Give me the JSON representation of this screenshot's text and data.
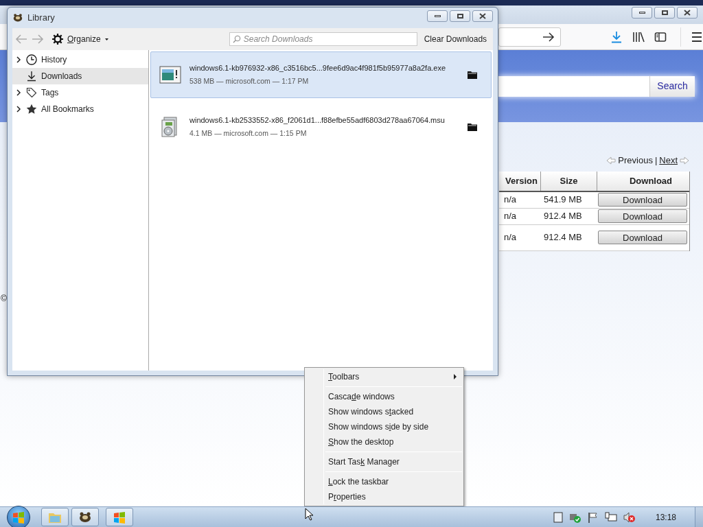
{
  "browser": {
    "search_button": "Search",
    "pager": {
      "previous": "Previous",
      "separator": "|",
      "next": "Next"
    },
    "table": {
      "columns": [
        "Version",
        "Size",
        "Download"
      ],
      "rows": [
        {
          "version": "n/a",
          "size": "541.9 MB",
          "button": "Download",
          "tall": false
        },
        {
          "version": "n/a",
          "size": "912.4 MB",
          "button": "Download",
          "tall": false
        },
        {
          "version": "n/a",
          "size": "912.4 MB",
          "button": "Download",
          "tall": true
        }
      ]
    },
    "edge_fragment": "©"
  },
  "library": {
    "title": "Library",
    "organize": {
      "key": "O",
      "post": "rganize"
    },
    "search": {
      "placeholder": "Search Downloads"
    },
    "clear_button": "Clear Downloads",
    "sidebar": [
      {
        "label": "History",
        "kind": "history",
        "collapsible": true,
        "selected": false
      },
      {
        "label": "Downloads",
        "kind": "downloads",
        "collapsible": false,
        "selected": true
      },
      {
        "label": "Tags",
        "kind": "tags",
        "collapsible": true,
        "selected": false
      },
      {
        "label": "All Bookmarks",
        "kind": "bookmarks",
        "collapsible": true,
        "selected": false
      }
    ],
    "downloads": [
      {
        "name": "windows6.1-kb976932-x86_c3516bc5...9fee6d9ac4f981f5b95977a8a2fa.exe",
        "details": "538 MB — microsoft.com — 1:17 PM",
        "kind": "exe",
        "selected": true
      },
      {
        "name": "windows6.1-kb2533552-x86_f2061d1...f88efbe55adf6803d278aa67064.msu",
        "details": "4.1 MB — microsoft.com — 1:15 PM",
        "kind": "msu",
        "selected": false
      }
    ]
  },
  "context_menu": [
    {
      "kind": "item",
      "key": "T",
      "post": "oolbars",
      "submenu": true
    },
    {
      "kind": "separator"
    },
    {
      "kind": "item",
      "pre": "Casca",
      "key": "d",
      "post": "e windows",
      "submenu": false
    },
    {
      "kind": "item",
      "pre": "Show windows s",
      "key": "t",
      "post": "acked",
      "submenu": false
    },
    {
      "kind": "item",
      "pre": "Show windows s",
      "key": "i",
      "post": "de by side",
      "submenu": false
    },
    {
      "kind": "item",
      "key": "S",
      "post": "how the desktop",
      "submenu": false
    },
    {
      "kind": "separator"
    },
    {
      "kind": "item",
      "pre": "Start Tas",
      "key": "k",
      "post": " Manager",
      "submenu": false
    },
    {
      "kind": "separator"
    },
    {
      "kind": "item",
      "key": "L",
      "post": "ock the taskbar",
      "submenu": false
    },
    {
      "kind": "item",
      "pre": "P",
      "key": "r",
      "post": "operties",
      "submenu": false
    }
  ],
  "taskbar": {
    "buttons": [
      {
        "kind": "explorer"
      },
      {
        "kind": "library"
      },
      {
        "kind": "windows"
      }
    ],
    "clock": "13:18"
  }
}
